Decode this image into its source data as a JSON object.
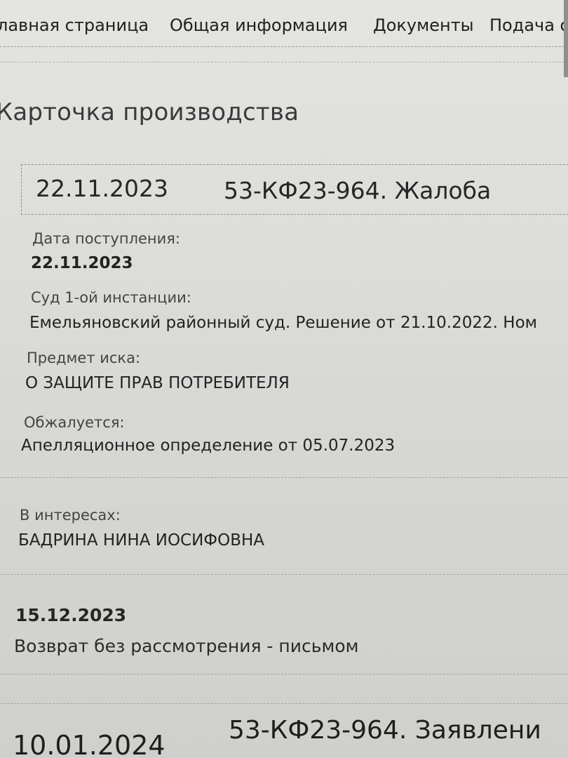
{
  "nav": {
    "items": [
      {
        "label": "лавная страница"
      },
      {
        "label": "Общая информация"
      },
      {
        "label": "Документы"
      },
      {
        "label": "Подача об"
      }
    ]
  },
  "page": {
    "title": "Карточка производства"
  },
  "case_header": {
    "date": "22.11.2023",
    "title": "53-КФ23-964. Жалоба"
  },
  "fields": {
    "received_label": "Дата поступления:",
    "received_value": "22.11.2023",
    "court_label": "Суд 1-ой инстанции:",
    "court_value": "Емельяновский районный суд. Решение от 21.10.2022.  Ном",
    "subject_label": "Предмет иска:",
    "subject_value": "О ЗАЩИТЕ ПРАВ ПОТРЕБИТЕЛЯ",
    "appealed_label": "Обжалуется:",
    "appealed_value": "Апелляционное определение от 05.07.2023",
    "interest_label": "В интересах:",
    "interest_value": "БАДРИНА НИНА ИОСИФОВНА"
  },
  "events": [
    {
      "date": "15.12.2023",
      "text": "Возврат без рассмотрения - письмом"
    }
  ],
  "next_case": {
    "date": "10.01.2024",
    "title": "53-КФ23-964. Заявлени"
  }
}
